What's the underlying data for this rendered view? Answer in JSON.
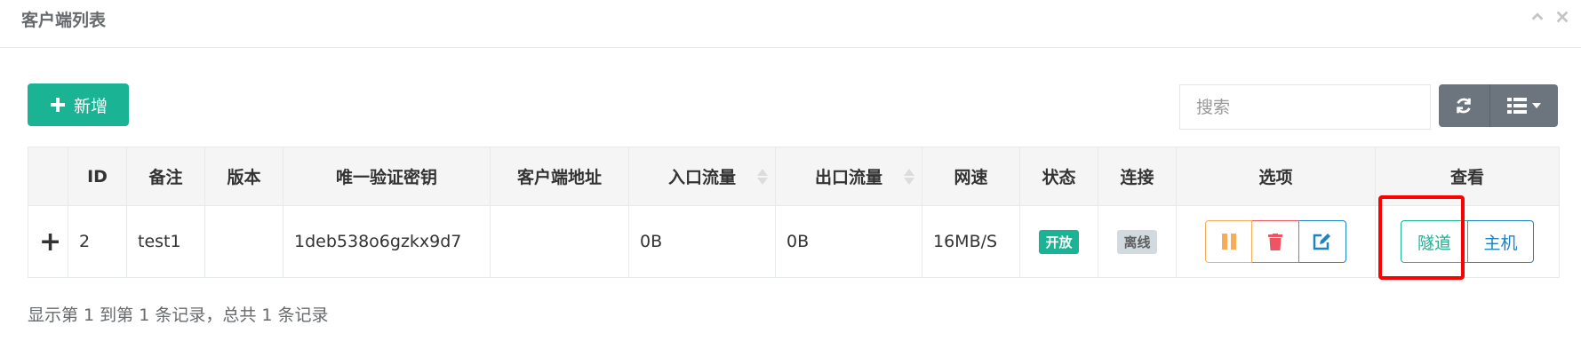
{
  "panel": {
    "title": "客户端列表"
  },
  "toolbar": {
    "add_label": "新增",
    "search_placeholder": "搜索"
  },
  "table": {
    "headers": [
      "",
      "ID",
      "备注",
      "版本",
      "唯一验证密钥",
      "客户端地址",
      "入口流量",
      "出口流量",
      "网速",
      "状态",
      "连接",
      "选项",
      "查看"
    ],
    "rows": [
      {
        "expand": "+",
        "id": "2",
        "remark": "test1",
        "version": "",
        "vkey": "1deb538o6gzkx9d7",
        "address": "",
        "inlet_flow": "0B",
        "export_flow": "0B",
        "rate": "16MB/S",
        "status": "开放",
        "connect": "离线",
        "view_tunnel": "隧道",
        "view_host": "主机"
      }
    ]
  },
  "footer": {
    "summary": "显示第 1 到第 1 条记录，总共 1 条记录"
  },
  "colors": {
    "primary": "#1ab394",
    "info": "#1c84c6",
    "warning": "#f8ac59",
    "danger": "#ed5565",
    "highlight": "#ff0000"
  },
  "icons": [
    "chevron-up-icon",
    "close-icon",
    "plus-icon",
    "refresh-icon",
    "columns-icon",
    "pause-icon",
    "trash-icon",
    "edit-icon"
  ]
}
